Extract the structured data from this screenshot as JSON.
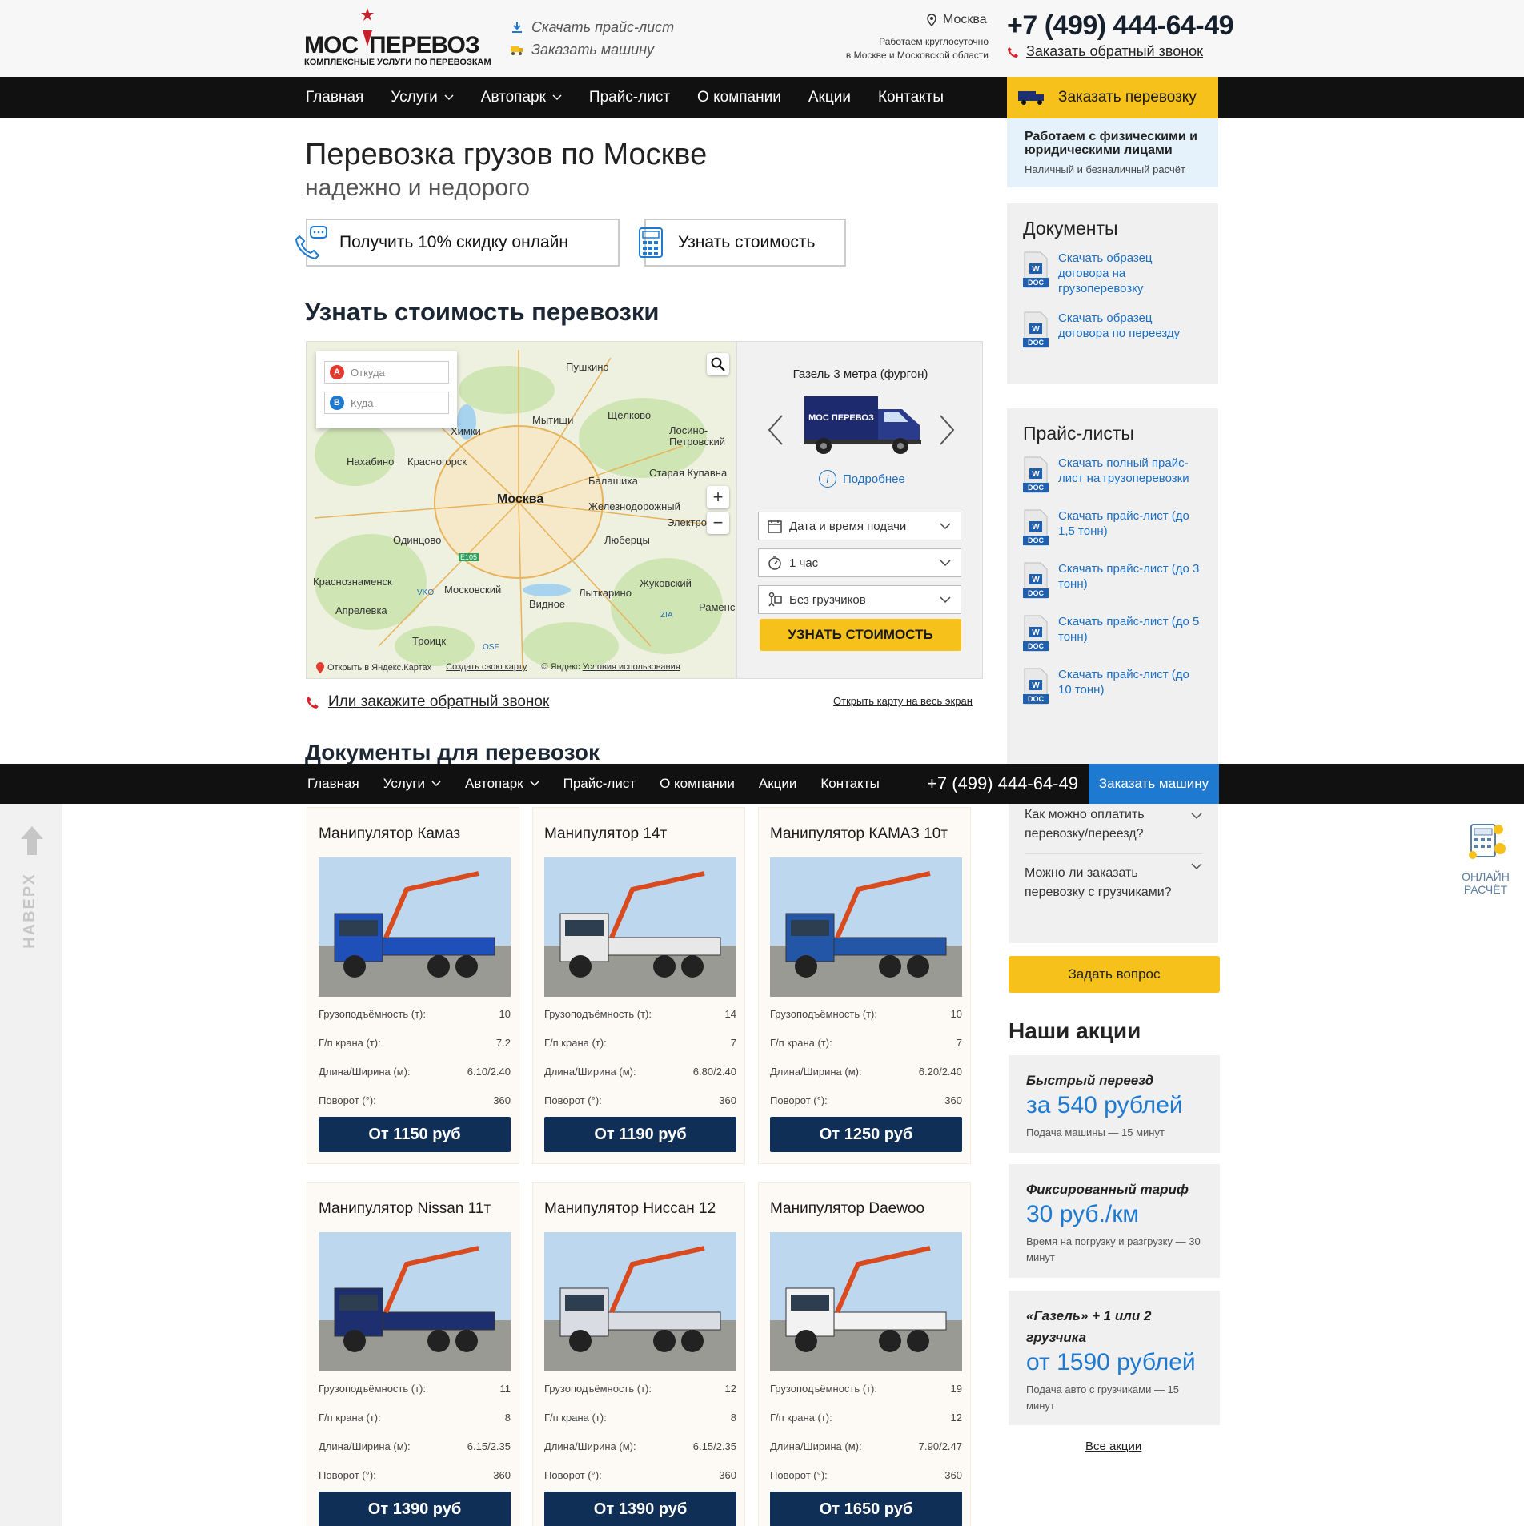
{
  "header": {
    "logo_text_a": "МОС",
    "logo_text_b": "ПЕРЕВОЗ",
    "logo_sub": "КОМПЛЕКСНЫЕ УСЛУГИ ПО ПЕРЕВОЗКАМ",
    "download_price": "Скачать прайс-лист",
    "order_car": "Заказать машину",
    "city": "Москва",
    "hours_a": "Работаем круглосуточно",
    "hours_b": "в Москве и Московской области",
    "phone": "+7 (499) 444-64-49",
    "callback": "Заказать обратный звонок"
  },
  "nav": {
    "items": [
      "Главная",
      "Услуги",
      "Автопарк",
      "Прайс-лист",
      "О компании",
      "Акции",
      "Контакты"
    ],
    "order_button": "Заказать перевозку"
  },
  "hero": {
    "title": "Перевозка грузов по Москве",
    "subtitle": "надежно и недорого",
    "discount_button": "Получить 10% скидку онлайн",
    "price_button": "Узнать стоимость"
  },
  "calculator": {
    "title": "Узнать стоимость перевозки",
    "from_placeholder": "Откуда",
    "to_placeholder": "Куда",
    "map_labels": [
      "Пушкино",
      "Щёлково",
      "Мытищи",
      "Химки",
      "Лосино-Петровский",
      "Нахабино",
      "Красногорск",
      "Старая Купавна",
      "Балашиха",
      "Москва",
      "Железнодорожный",
      "Электро",
      "Одинцово",
      "Люберцы",
      "Краснознаменск",
      "Московский",
      "Жуковский",
      "Апрелевка",
      "Лыткарино",
      "Видное",
      "Раменс",
      "Троицк",
      "VKO",
      "ZIA",
      "OSF",
      "E105"
    ],
    "map_open_yandex": "Открыть в Яндекс.Картах",
    "map_create": "Создать свою карту",
    "map_copyright": "© Яндекс",
    "map_terms": "Условия использования",
    "vehicle_name": "Газель 3 метра (фургон)",
    "vehicle_logo": "МОС ПЕРЕВОЗ",
    "more": "Подробнее",
    "date_select": "Дата и время подачи",
    "hours_select": "1 час",
    "movers_select": "Без грузчиков",
    "submit": "УЗНАТЬ СТОИМОСТЬ",
    "callback_link": "Или закажите обратный звонок",
    "fullscreen_link": "Открыть карту на весь экран"
  },
  "documents_heading": "Документы для перевозок",
  "sidebar": {
    "note_title": "Работаем с физическими и юридическими лицами",
    "note_sub": "Наличный и безналичный расчёт",
    "docs_title": "Документы",
    "docs": [
      "Скачать образец договора на грузоперевозку",
      "Скачать образец договора по переезду"
    ],
    "prices_title": "Прайс-листы",
    "prices": [
      "Скачать полный прайс-лист на грузоперевозки",
      "Скачать прайс-лист (до 1,5 тонн)",
      "Скачать прайс-лист (до 3 тонн)",
      "Скачать прайс-лист (до 5 тонн)",
      "Скачать прайс-лист (до 10 тонн)"
    ],
    "doc_badge": "DOC",
    "doc_letter": "W"
  },
  "sticky": {
    "items": [
      "Главная",
      "Услуги",
      "Автопарк",
      "Прайс-лист",
      "О компании",
      "Акции",
      "Контакты"
    ],
    "phone": "+7 (499) 444-64-49",
    "order": "Заказать машину"
  },
  "floating": {
    "to_top": "НАВЕРХ",
    "online_calc_a": "ОНЛАЙН",
    "online_calc_b": "РАСЧЁТ"
  },
  "spec_labels": {
    "capacity": "Грузоподъёмность (т):",
    "crane": "Г/п крана (т):",
    "size": "Длина/Ширина (м):",
    "rotation": "Поворот (°):"
  },
  "cards": [
    {
      "name": "Манипулятор Камаз",
      "capacity": "10",
      "crane": "7.2",
      "size": "6.10/2.40",
      "rotation": "360",
      "price": "От 1150 руб",
      "color": "#1f4fb8"
    },
    {
      "name": "Манипулятор 14т",
      "capacity": "14",
      "crane": "7",
      "size": "6.80/2.40",
      "rotation": "360",
      "price": "От 1190 руб",
      "color": "#e8e8e8"
    },
    {
      "name": "Манипулятор КАМАЗ 10т",
      "capacity": "10",
      "crane": "7",
      "size": "6.20/2.40",
      "rotation": "360",
      "price": "От 1250 руб",
      "color": "#2456a8"
    },
    {
      "name": "Манипулятор Nissan 11т",
      "capacity": "11",
      "crane": "8",
      "size": "6.15/2.35",
      "rotation": "360",
      "price": "От 1390 руб",
      "color": "#1d2f6e"
    },
    {
      "name": "Манипулятор Ниссан 12",
      "capacity": "12",
      "crane": "8",
      "size": "6.15/2.35",
      "rotation": "360",
      "price": "От 1390 руб",
      "color": "#d9dde3"
    },
    {
      "name": "Манипулятор Daewoo",
      "capacity": "19",
      "crane": "12",
      "size": "7.90/2.47",
      "rotation": "360",
      "price": "От 1650 руб",
      "color": "#f2f2f2"
    }
  ],
  "faq": [
    "Как можно оплатить перевозку/переезд?",
    "Можно ли заказать перевозку с грузчиками?"
  ],
  "ask_button": "Задать вопрос",
  "actions": {
    "title": "Наши акции",
    "items": [
      {
        "title": "Быстрый переезд",
        "price": "за 540 рублей",
        "sub": "Подача машины — 15 минут"
      },
      {
        "title": "Фиксированный тариф",
        "price": "30 руб./км",
        "sub": "Время на погрузку и разгрузку — 30 минут"
      },
      {
        "title": "«Газель» + 1 или 2 грузчика",
        "price": "от 1590 рублей",
        "sub": "Подача авто с грузчиками — 15 минут"
      }
    ],
    "all": "Все акции"
  },
  "colors": {
    "accent_yellow": "#f6c11a",
    "link_blue": "#1a6fc4",
    "dark_navy": "#0f2f56",
    "brand_red": "#c8202a"
  }
}
